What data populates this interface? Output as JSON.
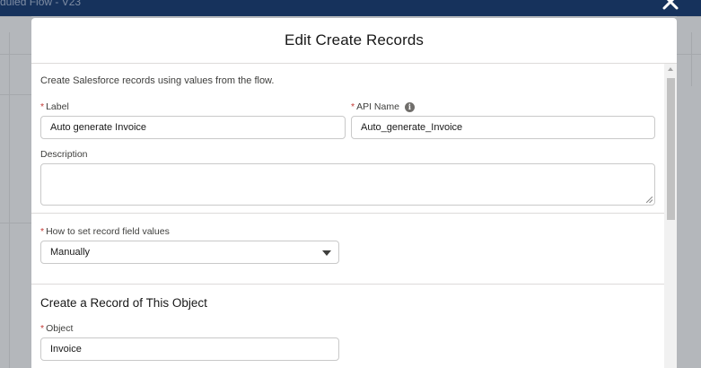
{
  "app": {
    "title": "duled Flow - V23"
  },
  "modal": {
    "title": "Edit Create Records",
    "intro": "Create Salesforce records using values from the flow.",
    "label_field": {
      "label": "Label",
      "value": "Auto generate Invoice"
    },
    "api_name_field": {
      "label": "API Name",
      "value": "Auto_generate_Invoice"
    },
    "description_field": {
      "label": "Description",
      "value": ""
    },
    "how_to_set": {
      "label": "How to set record field values",
      "selected": "Manually"
    },
    "section": {
      "title": "Create a Record of This Object"
    },
    "object_field": {
      "label": "Object",
      "value": "Invoice"
    }
  },
  "colors": {
    "header_bar": "#16325c",
    "required": "#c23934",
    "overlay": "#b4b7bb"
  }
}
